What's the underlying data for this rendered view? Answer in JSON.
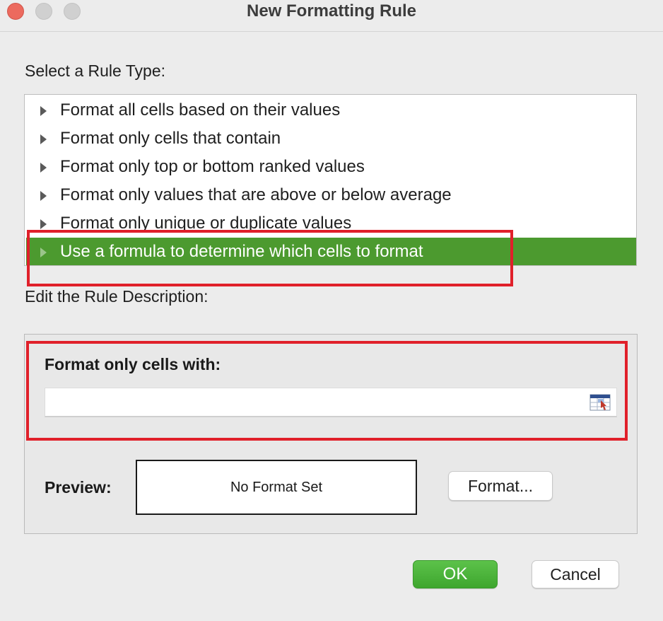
{
  "window": {
    "title": "New Formatting Rule"
  },
  "rule_type": {
    "label": "Select a Rule Type:",
    "items": [
      {
        "label": "Format all cells based on their values",
        "selected": false
      },
      {
        "label": "Format only cells that contain",
        "selected": false
      },
      {
        "label": "Format only top or bottom ranked values",
        "selected": false
      },
      {
        "label": "Format only values that are above or below average",
        "selected": false
      },
      {
        "label": "Format only unique or duplicate values",
        "selected": false
      },
      {
        "label": "Use a formula to determine which cells to format",
        "selected": true
      }
    ]
  },
  "description": {
    "label": "Edit the Rule Description:",
    "format_with_label": "Format only cells with:",
    "formula_value": "",
    "preview_label": "Preview:",
    "preview_text": "No Format Set",
    "format_button": "Format..."
  },
  "buttons": {
    "ok": "OK",
    "cancel": "Cancel"
  },
  "colors": {
    "selection": "#4c9a2f",
    "highlight_annotation": "#e0202a",
    "ok_button": "#3ea62e"
  }
}
